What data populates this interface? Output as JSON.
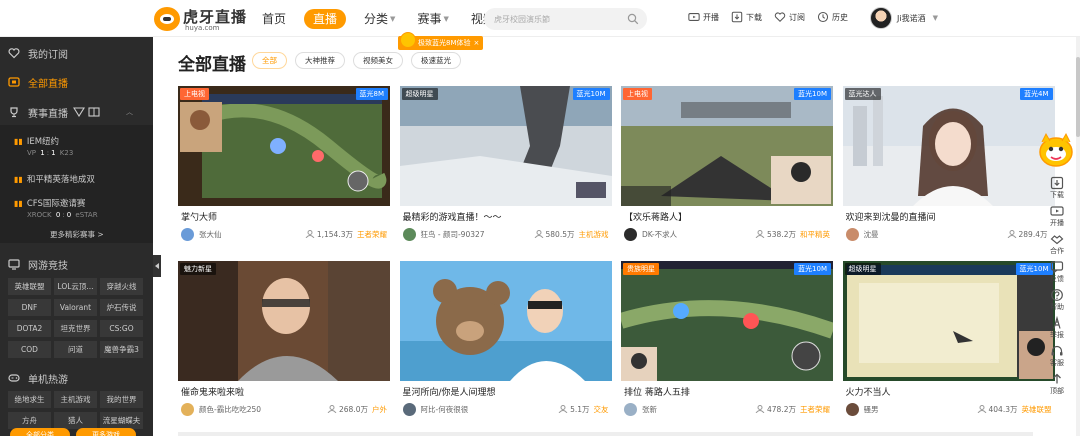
{
  "header": {
    "brand": "虎牙直播",
    "domain": "huya.com",
    "nav": [
      {
        "label": "首页",
        "active": false,
        "caret": false
      },
      {
        "label": "直播",
        "active": true,
        "caret": false
      },
      {
        "label": "分类",
        "active": false,
        "caret": true
      },
      {
        "label": "赛事",
        "active": false,
        "caret": true
      },
      {
        "label": "视频",
        "active": false,
        "caret": true
      }
    ],
    "search_placeholder": "虎牙校园演乐節",
    "tools": [
      {
        "icon": "tv-icon",
        "label": "开播"
      },
      {
        "icon": "download-icon",
        "label": "下载"
      },
      {
        "icon": "heart-icon",
        "label": "订阅"
      },
      {
        "icon": "clock-icon",
        "label": "历史"
      }
    ],
    "username": "Ji我诺酒"
  },
  "sidebar": {
    "top": [
      {
        "icon": "heart-icon",
        "label": "我的订阅",
        "active": false
      },
      {
        "icon": "live-icon",
        "label": "全部直播",
        "active": true
      },
      {
        "icon": "trophy-icon",
        "label": "赛事直播",
        "active": false
      }
    ],
    "matches": [
      {
        "title": "IEM纽约",
        "score": [
          "VP",
          "1",
          ":",
          "1",
          "K23"
        ]
      },
      {
        "title": "和平精英落地成双",
        "score": []
      },
      {
        "title": "CFS国际邀请赛",
        "score": [
          "XROCK",
          "0",
          ":",
          "0",
          "eSTAR"
        ]
      }
    ],
    "more_matches": "更多精彩赛事 >",
    "section_online": "网游竞技",
    "online_games": [
      "英雄联盟",
      "LOL云顶...",
      "穿越火线",
      "DNF",
      "Valorant",
      "炉石传说",
      "DOTA2",
      "坦克世界",
      "CS:GO",
      "COD",
      "问道",
      "魔兽争霸3"
    ],
    "section_single": "单机热游",
    "single_games": [
      "绝地求生",
      "主机游戏",
      "我的世界",
      "方舟",
      "猎人",
      "流星蝴蝶夫"
    ],
    "bottom_buttons": [
      "全部分类",
      "更多游戏"
    ]
  },
  "main": {
    "title": "全部直播",
    "filters": [
      {
        "label": "全部",
        "active": true
      },
      {
        "label": "大神推荐",
        "active": false
      },
      {
        "label": "视频美女",
        "active": false
      },
      {
        "label": "极速蓝光",
        "active": false
      }
    ],
    "promo": "极致蓝光8M体验"
  },
  "cards": [
    {
      "title": "掌勺大师",
      "name": "张大仙",
      "viewers": "1,154.3万",
      "category": "王者荣耀",
      "tag_left": "上电视",
      "tag_left_type": "live",
      "tag_right": "蓝光8M",
      "scene": "moba",
      "avatar": "#6a9bd8"
    },
    {
      "title": "最精彩的游戏直播！～～",
      "name": "狂鸟 - 颜司-90327",
      "viewers": "580.5万",
      "category": "主机游戏",
      "tag_left": "超级明星",
      "tag_left_type": "dark",
      "tag_right": "蓝光10M",
      "scene": "cliff",
      "avatar": "#5c8a5a"
    },
    {
      "title": "【欢乐蒋路人】",
      "name": "DK-不求人",
      "viewers": "538.2万",
      "category": "和平精英",
      "tag_left": "上电视",
      "tag_left_type": "live",
      "tag_right": "蓝光10M",
      "scene": "shooter",
      "avatar": "#2b2b2b"
    },
    {
      "title": "欢迎来到沈曼的直播间",
      "name": "沈曼",
      "viewers": "289.4万",
      "category": "",
      "tag_left": "蓝光达人",
      "tag_left_type": "dark",
      "tag_right": "蓝光4M",
      "scene": "portrait",
      "avatar": "#c98c6a"
    },
    {
      "title": "催命鬼来啦来啦",
      "name": "颜色-霸比吃吃250",
      "viewers": "268.0万",
      "category": "户外",
      "tag_left": "魅力新星",
      "tag_left_type": "dark",
      "tag_right": "",
      "scene": "room",
      "avatar": "#e3b15a"
    },
    {
      "title": "星河所向/你是人间理想",
      "name": "阿比-何夜很很",
      "viewers": "5.1万",
      "category": "交友",
      "tag_left": "",
      "tag_left_type": "",
      "tag_right": "",
      "scene": "bear",
      "avatar": "#5a6a7a"
    },
    {
      "title": "排位 蒋路人五排",
      "name": "张新",
      "viewers": "478.2万",
      "category": "王者荣耀",
      "tag_left": "贵族明星",
      "tag_left_type": "hot",
      "tag_right": "蓝光10M",
      "scene": "moba2",
      "avatar": "#9ab0c6"
    },
    {
      "title": "火力不当人",
      "name": "骚男",
      "viewers": "404.3万",
      "category": "英雄联盟",
      "tag_left": "超级明星",
      "tag_left_type": "dark",
      "tag_right": "蓝光10M",
      "scene": "lol",
      "avatar": "#6b4c3b"
    }
  ],
  "rail": [
    {
      "icon": "download-icon",
      "label": "下载"
    },
    {
      "icon": "tv-icon",
      "label": "开播"
    },
    {
      "icon": "handshake-icon",
      "label": "合作"
    },
    {
      "icon": "chat-icon",
      "label": "反馈"
    },
    {
      "icon": "help-icon",
      "label": "帮助"
    },
    {
      "icon": "tower-icon",
      "label": "举报"
    },
    {
      "icon": "headset-icon",
      "label": "客服"
    },
    {
      "icon": "up-arrow-icon",
      "label": "顶部"
    }
  ]
}
